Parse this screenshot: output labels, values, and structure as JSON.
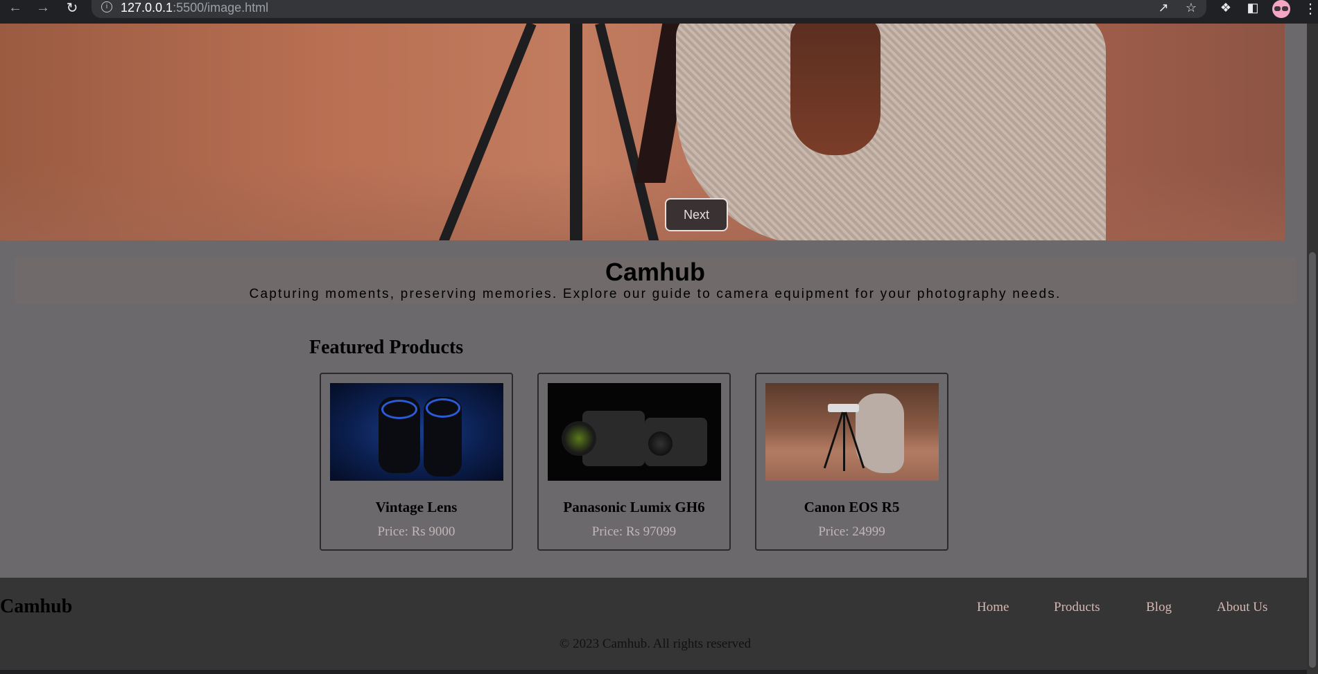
{
  "browser": {
    "url_host": "127.0.0.1",
    "url_path": ":5500/image.html"
  },
  "hero": {
    "next_label": "Next"
  },
  "banner": {
    "title": "Camhub",
    "tagline": "Capturing moments, preserving memories. Explore our guide to camera equipment for your photography needs."
  },
  "featured": {
    "title": "Featured Products",
    "products": [
      {
        "name": "Vintage Lens",
        "price": "Price: Rs 9000"
      },
      {
        "name": "Panasonic Lumix GH6",
        "price": "Price: Rs 97099"
      },
      {
        "name": "Canon EOS R5",
        "price": "Price: 24999"
      }
    ]
  },
  "footer": {
    "brand": "Camhub",
    "nav": [
      "Home",
      "Products",
      "Blog",
      "About Us"
    ],
    "copyright": "© 2023 Camhub. All rights reserved"
  },
  "colors": {
    "page_bg": "#6b696c",
    "banner_bg": "#706a6a",
    "footer_bg": "#363536",
    "price_text": "#c2b6b6",
    "footer_link": "#d6b8b0"
  }
}
